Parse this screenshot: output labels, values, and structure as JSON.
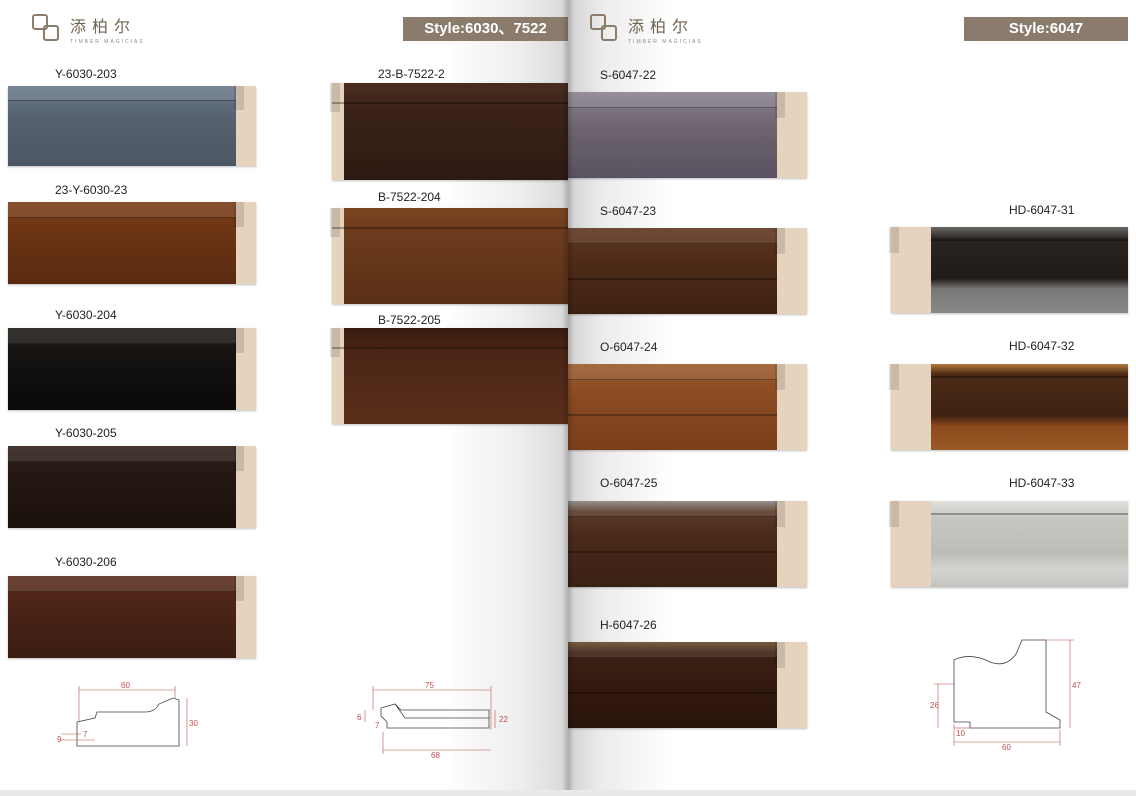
{
  "left_page": {
    "brand": {
      "cn": "添柏尔",
      "en": "TIMBER MAGICIAS"
    },
    "style_label": "Style:6030、7522",
    "samples": [
      {
        "code": "Y-6030-203",
        "color": "#5d6b7a"
      },
      {
        "code": "23-Y-6030-23",
        "color": "#6a3414"
      },
      {
        "code": "Y-6030-204",
        "color": "#141210"
      },
      {
        "code": "Y-6030-205",
        "color": "#241712"
      },
      {
        "code": "Y-6030-206",
        "color": "#4a2416"
      },
      {
        "code": "23-B-7522-2",
        "color": "#3a2219"
      },
      {
        "code": "B-7522-204",
        "color": "#6b3a1c"
      },
      {
        "code": "B-7522-205",
        "color": "#4b2616"
      }
    ],
    "profile_a": {
      "width": "60",
      "height": "30",
      "small_a": "9",
      "small_b": "7"
    },
    "profile_b": {
      "top": "75",
      "bottom": "68",
      "height": "22",
      "small_a": "6",
      "small_b": "7"
    }
  },
  "right_page": {
    "brand": {
      "cn": "添柏尔",
      "en": "TIMBER MAGICIAS"
    },
    "style_label": "Style:6047",
    "samples": [
      {
        "code": "S-6047-22",
        "color": "#6e6470"
      },
      {
        "code": "S-6047-23",
        "color": "#4e2b18"
      },
      {
        "code": "O-6047-24",
        "color": "#8a4a22"
      },
      {
        "code": "O-6047-25",
        "color": "#4a2a1a"
      },
      {
        "code": "H-6047-26",
        "color": "#3c2014"
      },
      {
        "code": "HD-6047-31",
        "color": "#2a2420"
      },
      {
        "code": "HD-6047-32",
        "color": "#4c2a16"
      },
      {
        "code": "HD-6047-33",
        "color": "#c9c7c2"
      }
    ],
    "profile": {
      "width": "60",
      "height": "47",
      "inner": "26",
      "base": "10"
    }
  }
}
